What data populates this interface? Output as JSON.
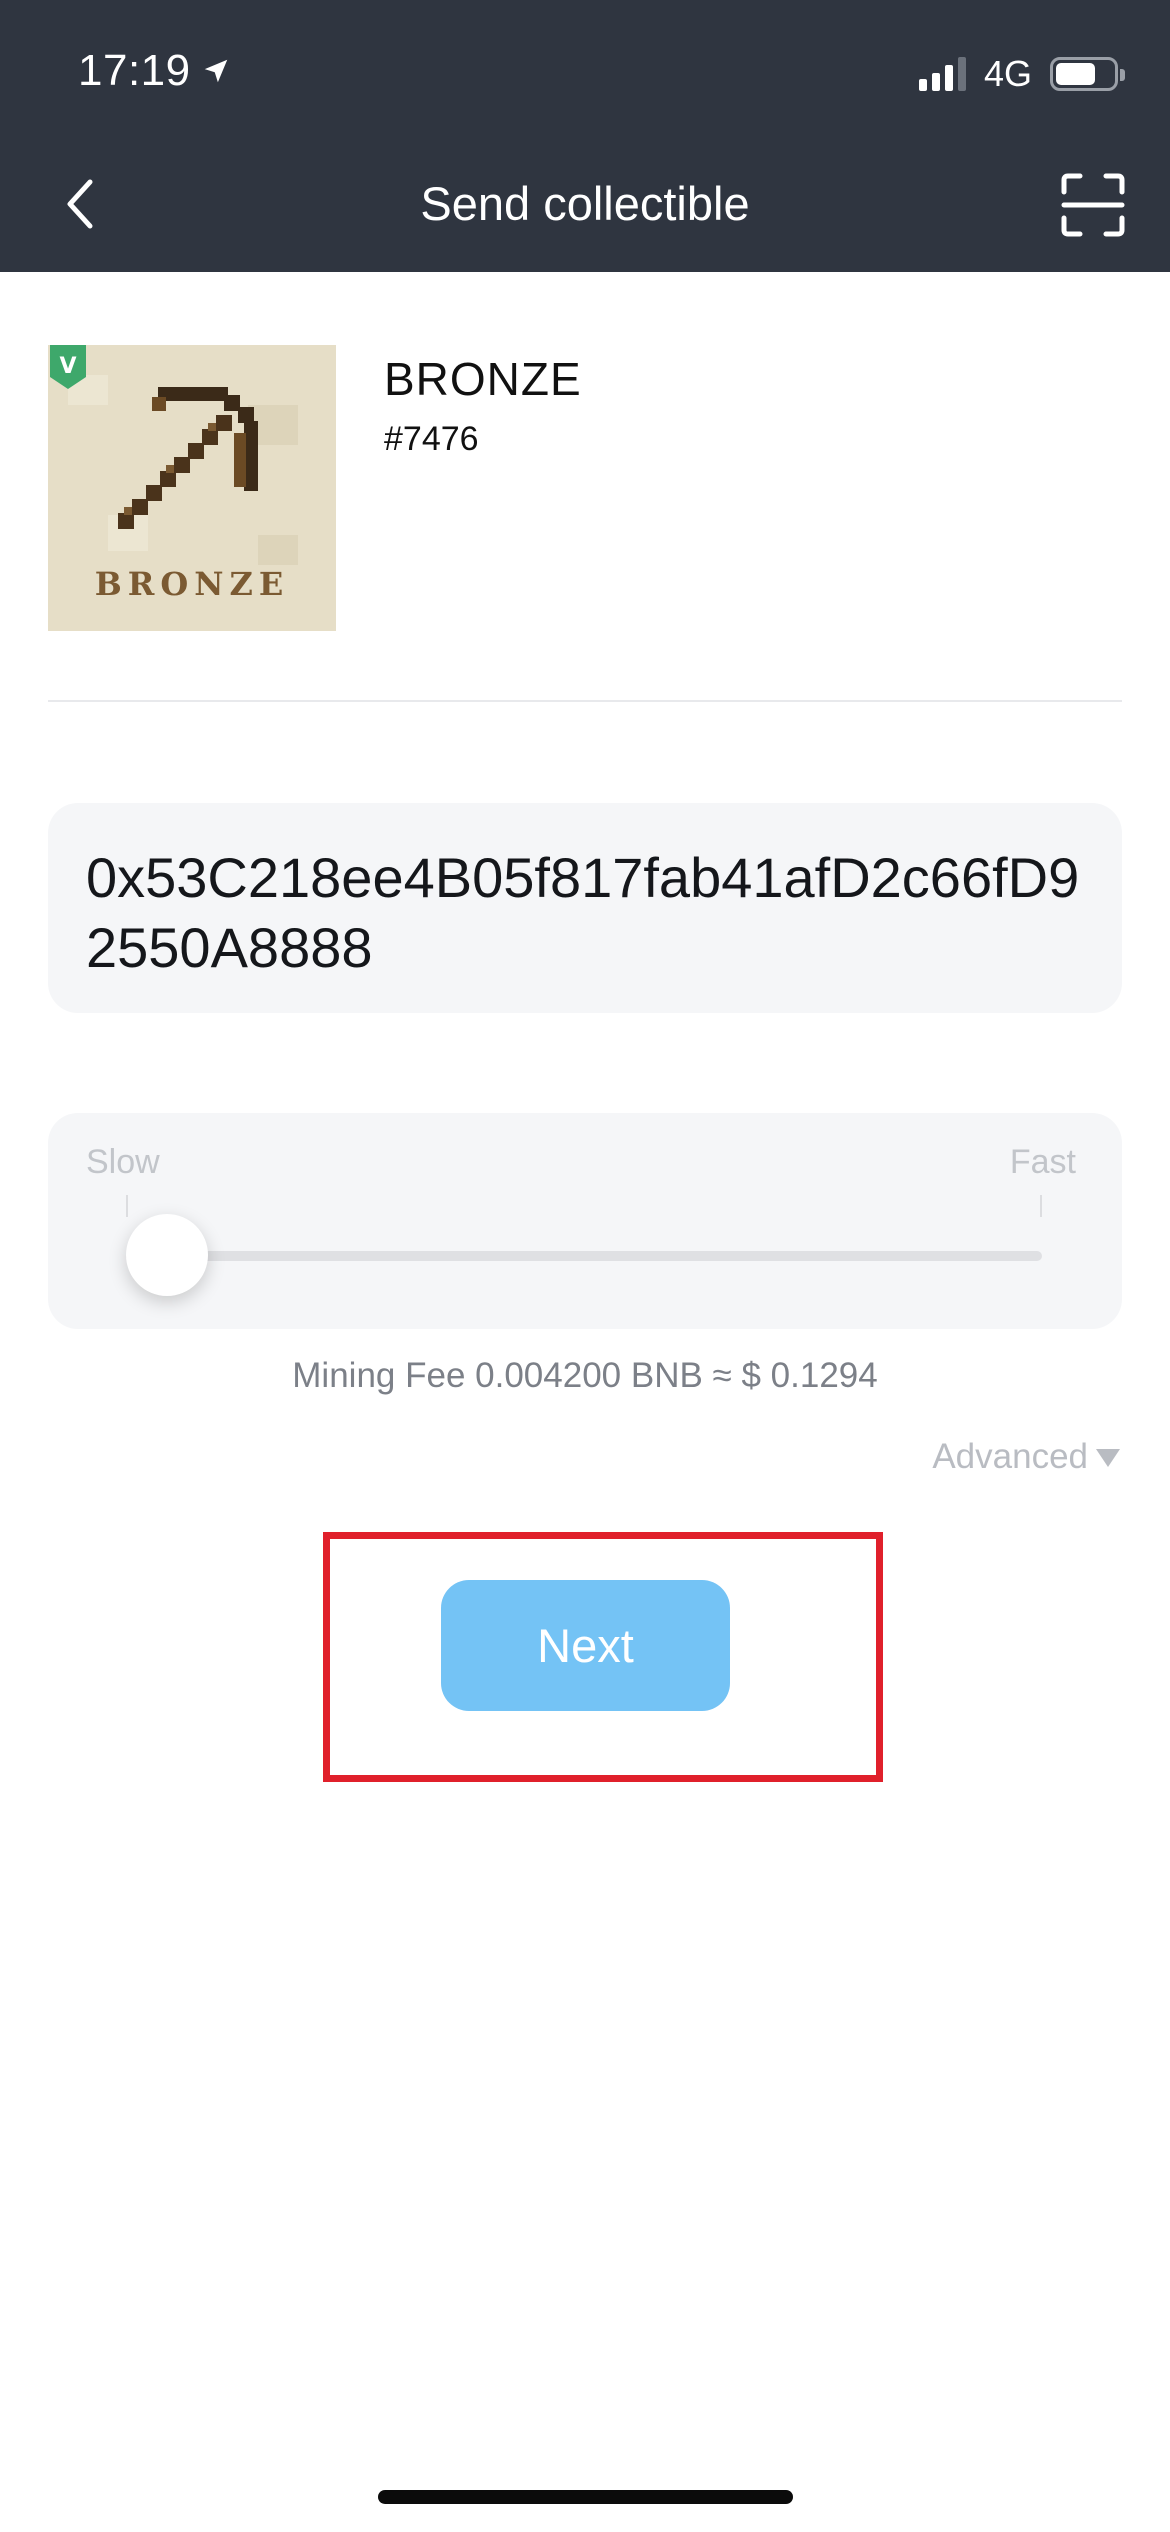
{
  "status_bar": {
    "time": "17:19",
    "network": "4G",
    "battery_level": 0.7,
    "signal_bars_active": 3
  },
  "nav": {
    "title": "Send collectible",
    "back_icon": "chevron-left-icon",
    "scan_icon": "scan-frame-icon"
  },
  "collectible": {
    "name": "BRONZE",
    "token_id": "#7476",
    "image_text": "BRONZE",
    "badge_text": "V"
  },
  "recipient": {
    "address": "0x53C218ee4B05f817fab41afD2c66fD92550A8888"
  },
  "fee": {
    "slow_label": "Slow",
    "fast_label": "Fast",
    "slider_level": 0,
    "mining_fee_text": "Mining Fee 0.004200 BNB ≈ $ 0.1294",
    "advanced_label": "Advanced"
  },
  "actions": {
    "next_label": "Next"
  },
  "colors": {
    "header_bg": "#2f3540",
    "accent": "#74c3f5",
    "highlight": "#e0202b"
  }
}
